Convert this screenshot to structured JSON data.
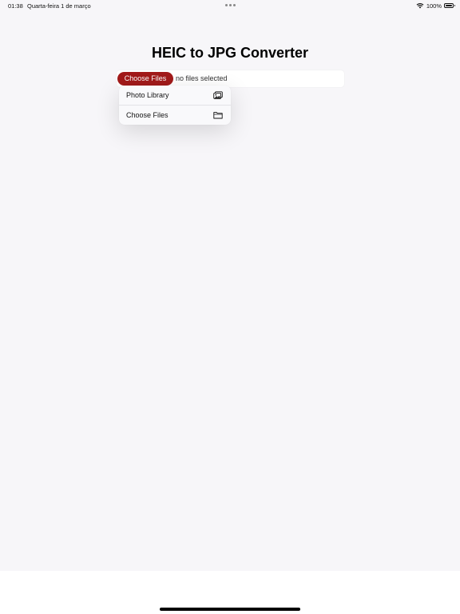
{
  "status_bar": {
    "time": "01:38",
    "date": "Quarta-feira 1 de março",
    "battery": "100%",
    "icons": [
      "wifi-icon",
      "battery-icon"
    ]
  },
  "page": {
    "title": "HEIC to JPG Converter"
  },
  "file_input": {
    "button_label": "Choose Files",
    "status_text": "no files selected",
    "button_color": "#a21a1a"
  },
  "menu": {
    "items": [
      {
        "label": "Photo Library",
        "icon": "photo-library-icon"
      },
      {
        "label": "Choose Files",
        "icon": "folder-icon"
      }
    ]
  },
  "colors": {
    "page_background": "#f7f6f9",
    "accent": "#a21a1a"
  }
}
